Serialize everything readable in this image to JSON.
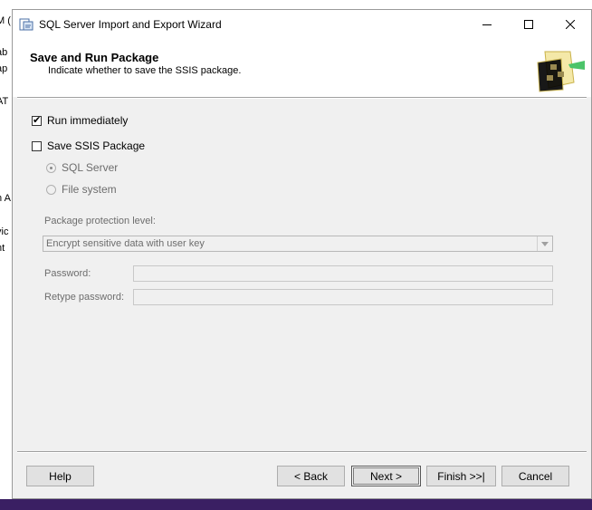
{
  "background": {
    "fragments": [
      "M (",
      "ab",
      "ap",
      "AT",
      "n A",
      "vic",
      "nt"
    ]
  },
  "window": {
    "title": "SQL Server Import and Export Wizard",
    "controls": {
      "minimize": "─",
      "maximize": "☐",
      "close": "✕"
    }
  },
  "header": {
    "title": "Save and Run Package",
    "subtitle": "Indicate whether to save the SSIS package."
  },
  "options": {
    "run_immediately": {
      "label": "Run immediately",
      "checked": true
    },
    "save_ssis": {
      "label": "Save SSIS Package",
      "checked": false
    },
    "sql_server": {
      "label": "SQL Server",
      "selected": true,
      "disabled": true
    },
    "file_system": {
      "label": "File system",
      "selected": false,
      "disabled": true
    }
  },
  "protection": {
    "label": "Package protection level:",
    "value": "Encrypt sensitive data with user key"
  },
  "password": {
    "label": "Password:",
    "value": ""
  },
  "retype_password": {
    "label": "Retype password:",
    "value": ""
  },
  "buttons": {
    "help": "Help",
    "back": "< Back",
    "next": "Next >",
    "finish": "Finish >>|",
    "cancel": "Cancel"
  }
}
